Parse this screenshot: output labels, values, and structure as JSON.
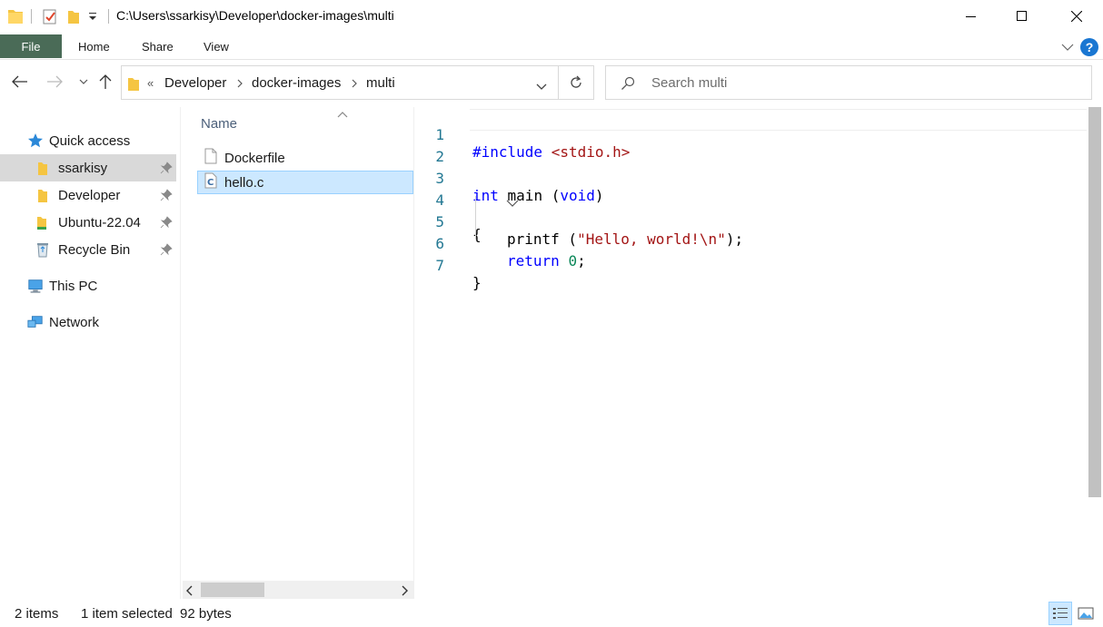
{
  "window": {
    "title": "C:\\Users\\ssarkisy\\Developer\\docker-images\\multi"
  },
  "ribbon": {
    "tabs": [
      {
        "label": "File"
      },
      {
        "label": "Home"
      },
      {
        "label": "Share"
      },
      {
        "label": "View"
      }
    ],
    "help": "?"
  },
  "address": {
    "overflow": "«",
    "breadcrumbs": [
      "Developer",
      "docker-images",
      "multi"
    ]
  },
  "search": {
    "placeholder": "Search multi"
  },
  "nav": {
    "quick_access": "Quick access",
    "items": [
      {
        "label": "ssarkisy",
        "icon": "folder-icon",
        "pinned": true,
        "selected": true
      },
      {
        "label": "Developer",
        "icon": "folder-icon",
        "pinned": true,
        "selected": false
      },
      {
        "label": "Ubuntu-22.04",
        "icon": "linux-folder-icon",
        "pinned": true,
        "selected": false
      },
      {
        "label": "Recycle Bin",
        "icon": "recycle-bin-icon",
        "pinned": true,
        "selected": false
      }
    ],
    "this_pc": "This PC",
    "network": "Network"
  },
  "files": {
    "column_header": "Name",
    "items": [
      {
        "name": "Dockerfile",
        "icon": "document-icon",
        "selected": false
      },
      {
        "name": "hello.c",
        "icon": "c-file-icon",
        "selected": true
      }
    ]
  },
  "preview": {
    "line_numbers": [
      "1",
      "2",
      "3",
      "4",
      "5",
      "6",
      "7"
    ],
    "lines": [
      "#include <stdio.h>",
      "",
      "int main (void)",
      "{",
      "    printf (\"Hello, world!\\n\");",
      "    return 0;",
      "}"
    ],
    "tokens": {
      "include_directive": "#include",
      "include_file": "<stdio.h>",
      "kw_int": "int",
      "main_sig": " main (",
      "kw_void": "void",
      "close_paren": ")",
      "open_brace": "{",
      "printf_call": "printf (",
      "hello_string": "\"Hello, world!\\n\"",
      "printf_end": ");",
      "kw_return": "return",
      "zero": "0",
      "semicolon": ";",
      "close_brace": "}"
    },
    "colors": {
      "keyword": "#0000ff",
      "string": "#a31515",
      "number": "#098658",
      "line_number": "#237893"
    }
  },
  "status": {
    "item_count": "2 items",
    "selection": "1 item selected",
    "size": "92 bytes"
  }
}
